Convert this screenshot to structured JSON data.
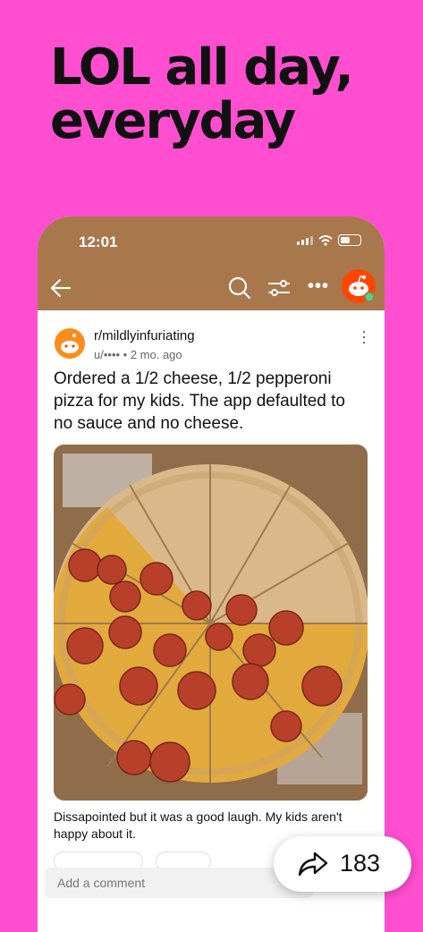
{
  "headline": "LOL all day, everyday",
  "status": {
    "time": "12:01"
  },
  "nav": {
    "back_icon": "arrow-left-icon",
    "search_icon": "search-icon",
    "filter_icon": "filter-icon",
    "more_label": "•••"
  },
  "post": {
    "subreddit": "r/mildlyinfuriating",
    "meta": "u/•••• • 2 mo. ago",
    "title": "Ordered a 1/2 cheese, 1/2 pepperoni pizza for my kids. The app defaulted to no sauce and no cheese.",
    "caption": "Dissapointed but it was a good laugh. My kids aren't happy about it."
  },
  "comment": {
    "placeholder": "Add a comment"
  },
  "share": {
    "count": "183"
  },
  "colors": {
    "background": "#FF4FD0",
    "header": "#A9774C",
    "reddit_orange": "#FF4500"
  }
}
